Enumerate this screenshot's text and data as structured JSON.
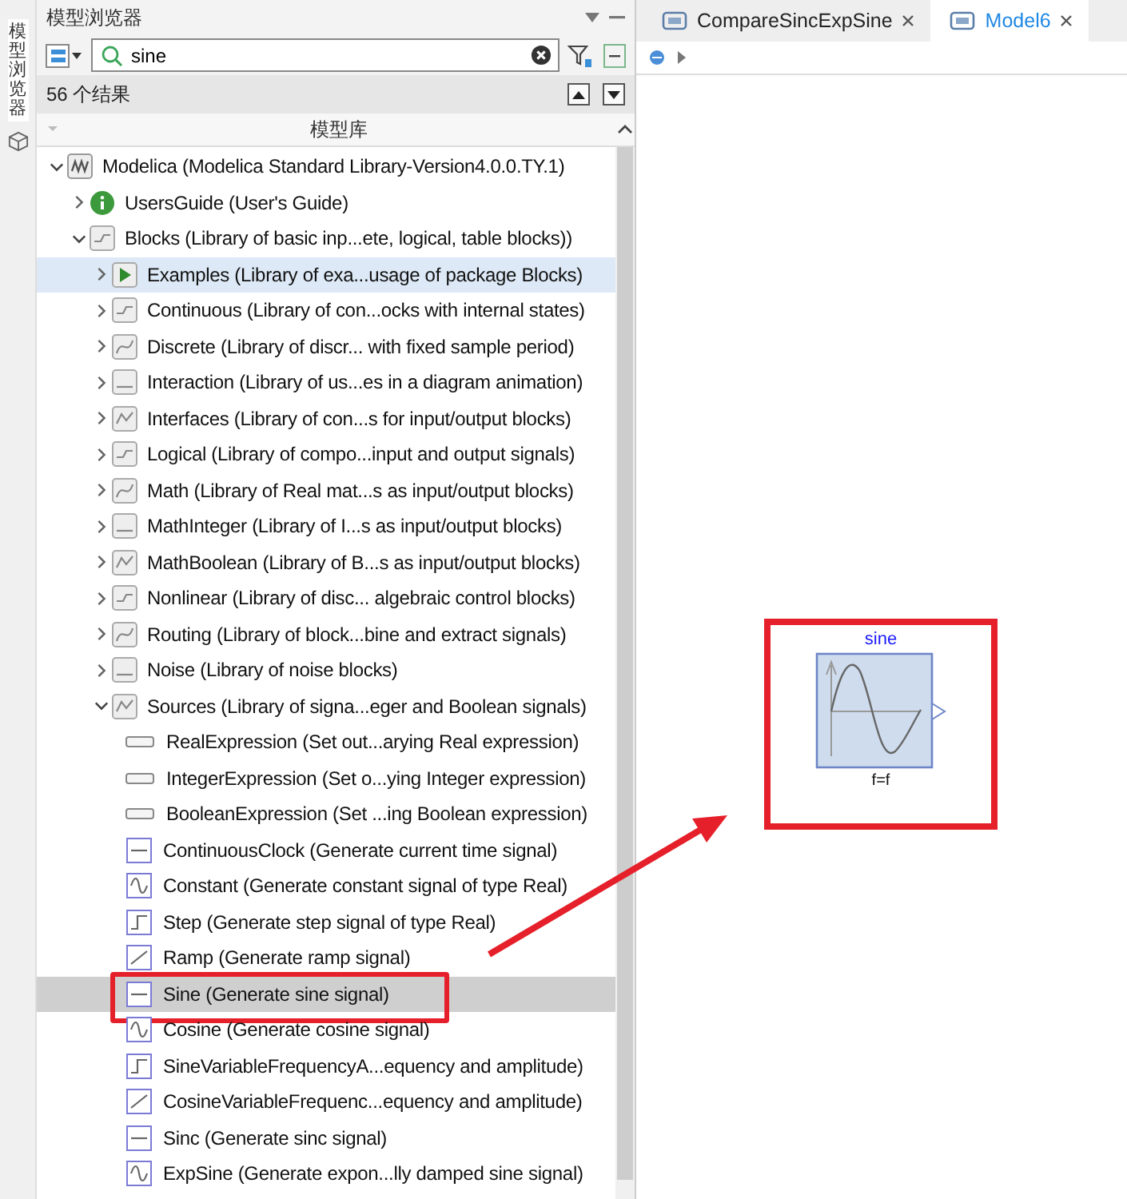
{
  "side_tab": {
    "label": "模型浏览器"
  },
  "browser": {
    "title": "模型浏览器",
    "search": {
      "value": "sine"
    },
    "result_count": "56 个结果",
    "column_header": "模型库",
    "tree": [
      {
        "label": "Modelica (Modelica Standard Library-Version4.0.0.TY.1)",
        "kind": "root",
        "expanded": true,
        "selected": false,
        "hovered": false,
        "children": [
          {
            "label": "UsersGuide (User's Guide)",
            "kind": "info",
            "expanded": false,
            "selected": false,
            "hovered": false
          },
          {
            "label": "Blocks (Library of basic inp...ete, logical, table blocks))",
            "kind": "package",
            "expanded": true,
            "selected": false,
            "hovered": false,
            "children": [
              {
                "label": "Examples (Library of exa...usage of package Blocks)",
                "kind": "examples",
                "expanded": false,
                "selected": false,
                "hovered": true
              },
              {
                "label": "Continuous (Library of con...ocks with internal states)",
                "kind": "package",
                "expanded": false,
                "selected": false,
                "hovered": false
              },
              {
                "label": "Discrete (Library of discr... with fixed sample period)",
                "kind": "package",
                "expanded": false,
                "selected": false,
                "hovered": false
              },
              {
                "label": "Interaction (Library of us...es in a diagram animation)",
                "kind": "package",
                "expanded": false,
                "selected": false,
                "hovered": false
              },
              {
                "label": "Interfaces (Library of con...s for input/output blocks)",
                "kind": "package",
                "expanded": false,
                "selected": false,
                "hovered": false
              },
              {
                "label": "Logical (Library of compo...input and output signals)",
                "kind": "package",
                "expanded": false,
                "selected": false,
                "hovered": false
              },
              {
                "label": "Math (Library of Real mat...s as input/output blocks)",
                "kind": "package",
                "expanded": false,
                "selected": false,
                "hovered": false
              },
              {
                "label": "MathInteger (Library of I...s as input/output blocks)",
                "kind": "package",
                "expanded": false,
                "selected": false,
                "hovered": false
              },
              {
                "label": "MathBoolean (Library of B...s as input/output blocks)",
                "kind": "package",
                "expanded": false,
                "selected": false,
                "hovered": false
              },
              {
                "label": "Nonlinear (Library of disc... algebraic control blocks)",
                "kind": "package",
                "expanded": false,
                "selected": false,
                "hovered": false
              },
              {
                "label": "Routing (Library of block...bine and extract signals)",
                "kind": "package",
                "expanded": false,
                "selected": false,
                "hovered": false
              },
              {
                "label": "Noise (Library of noise blocks)",
                "kind": "package",
                "expanded": false,
                "selected": false,
                "hovered": false
              },
              {
                "label": "Sources (Library of signa...eger and Boolean signals)",
                "kind": "package",
                "expanded": true,
                "selected": false,
                "hovered": false,
                "children": [
                  {
                    "label": "RealExpression (Set out...arying Real expression)",
                    "kind": "expression",
                    "selected": false,
                    "hovered": false
                  },
                  {
                    "label": "IntegerExpression (Set o...ying Integer expression)",
                    "kind": "expression",
                    "selected": false,
                    "hovered": false
                  },
                  {
                    "label": "BooleanExpression (Set ...ing Boolean expression)",
                    "kind": "expression",
                    "selected": false,
                    "hovered": false
                  },
                  {
                    "label": "ContinuousClock (Generate current time signal)",
                    "kind": "model",
                    "selected": false,
                    "hovered": false
                  },
                  {
                    "label": "Constant (Generate constant signal of type Real)",
                    "kind": "model",
                    "selected": false,
                    "hovered": false
                  },
                  {
                    "label": "Step (Generate step signal of type Real)",
                    "kind": "model",
                    "selected": false,
                    "hovered": false
                  },
                  {
                    "label": "Ramp (Generate ramp signal)",
                    "kind": "model",
                    "selected": false,
                    "hovered": false
                  },
                  {
                    "label": "Sine (Generate sine signal)",
                    "kind": "model",
                    "selected": true,
                    "hovered": false,
                    "annotated": true
                  },
                  {
                    "label": "Cosine (Generate cosine signal)",
                    "kind": "model",
                    "selected": false,
                    "hovered": false
                  },
                  {
                    "label": "SineVariableFrequencyA...equency and amplitude)",
                    "kind": "model",
                    "selected": false,
                    "hovered": false
                  },
                  {
                    "label": "CosineVariableFrequenc...equency and amplitude)",
                    "kind": "model",
                    "selected": false,
                    "hovered": false
                  },
                  {
                    "label": "Sinc (Generate sinc signal)",
                    "kind": "model",
                    "selected": false,
                    "hovered": false
                  },
                  {
                    "label": "ExpSine (Generate expon...lly damped sine signal)",
                    "kind": "model",
                    "selected": false,
                    "hovered": false
                  }
                ]
              }
            ]
          }
        ]
      }
    ]
  },
  "tabs": [
    {
      "label": "CompareSincExpSine",
      "selected": false
    },
    {
      "label": "Model6",
      "selected": true
    }
  ],
  "canvas": {
    "block": {
      "name": "sine",
      "parameter": "f=f",
      "annotated": true
    }
  }
}
